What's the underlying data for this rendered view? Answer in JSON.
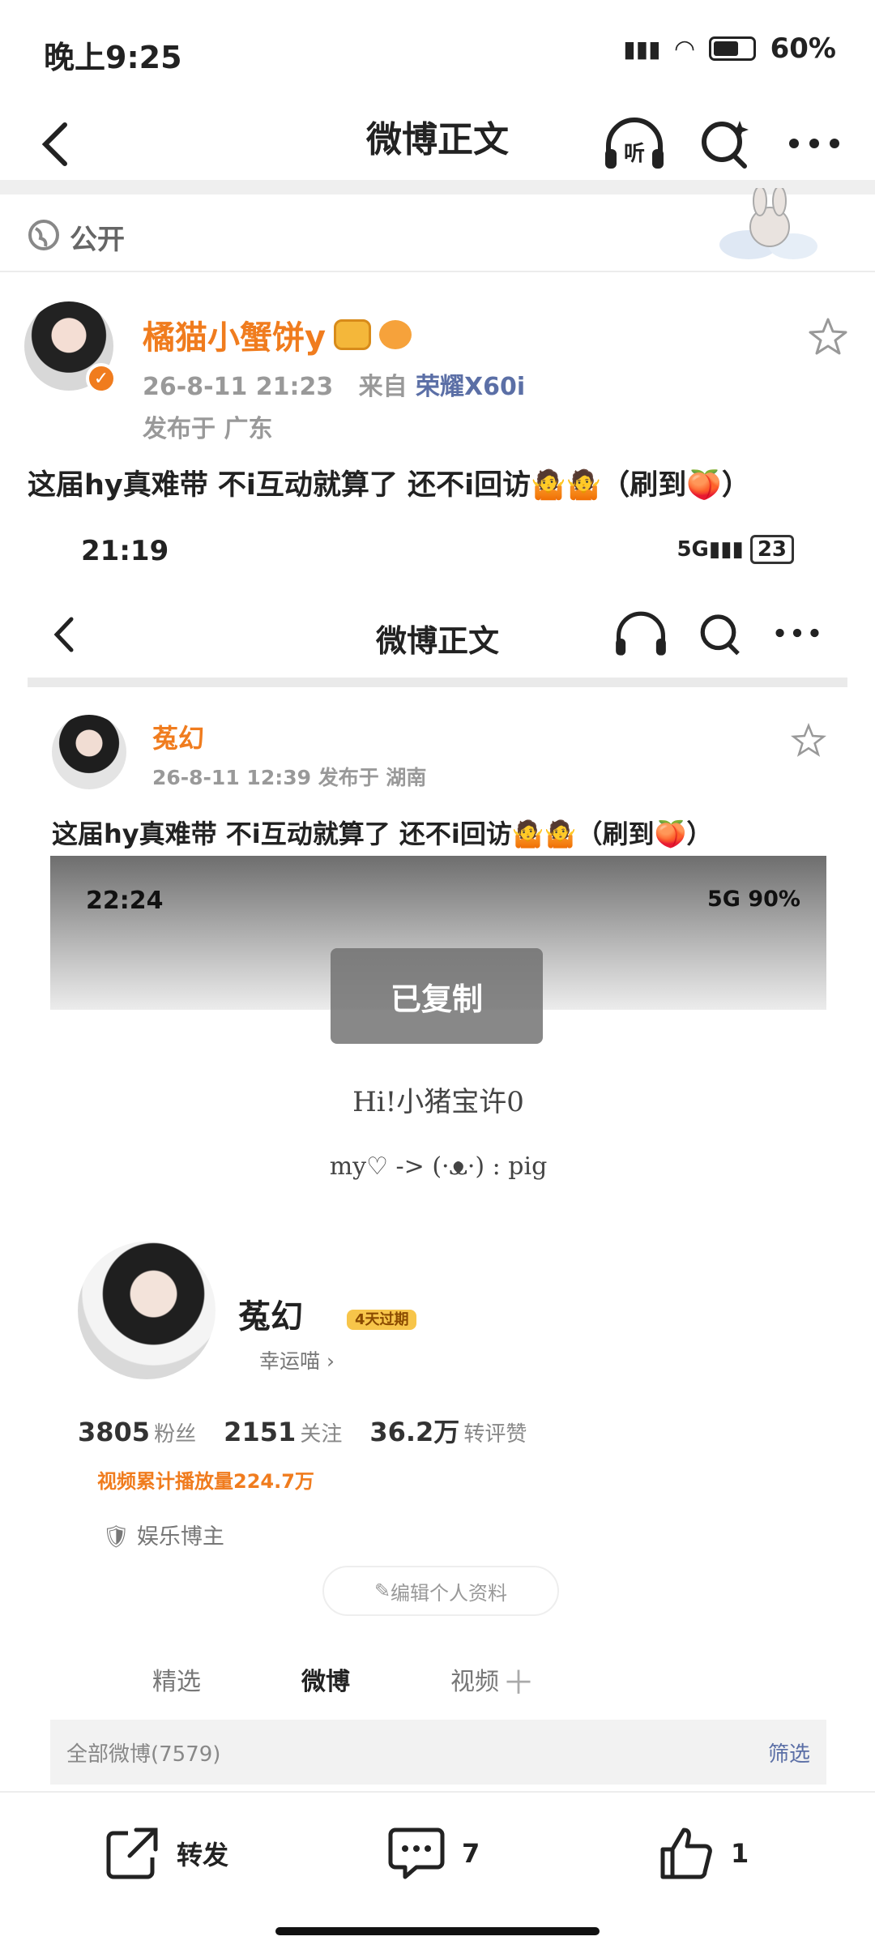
{
  "status_bar": {
    "time": "晚上9:25",
    "battery": "60%"
  },
  "header": {
    "title": "微博正文",
    "listen_icon_label": "听"
  },
  "visibility": {
    "label": "公开"
  },
  "post": {
    "author": "橘猫小蟹饼y",
    "date": "26-8-11 21:23",
    "from_label": "来自",
    "device": "荣耀X60i",
    "location": "发布于 广东",
    "text": "这届hy真难带 不i互动就算了 还不i回访🤷🤷（刷到🍑）"
  },
  "embedded": {
    "time": "21:19",
    "battery": "23",
    "header_title": "微博正文",
    "author": "菟幻",
    "meta": "26-8-11 12:39  发布于 湖南",
    "text": "这届hy真难带 不i互动就算了 还不i回访🤷🤷（刷到🍑）"
  },
  "inner": {
    "time": "22:24",
    "status": "5G  90%",
    "toast": "已复制",
    "handwriting_1": "Hi!小猪宝许0",
    "handwriting_2": "my♡ -> (·ᴥ·) : pig",
    "name": "菟幻",
    "badge": "4天过期",
    "lucky": "幸运喵 ›",
    "stats": [
      {
        "value": "3805",
        "label": "粉丝"
      },
      {
        "value": "2151",
        "label": "关注"
      },
      {
        "value": "36.2万",
        "label": "转评赞"
      }
    ],
    "plays": "视频累计播放量224.7万",
    "category": "娱乐博主",
    "edit_button": "编辑个人资料",
    "tabs": [
      "精选",
      "微博",
      "视频"
    ],
    "all_weibo": "全部微博(7579)",
    "filter": "筛选"
  },
  "actions": {
    "repost": "转发",
    "comments": "7",
    "likes": "1"
  },
  "colors": {
    "accent": "#f07c1e",
    "link": "#5b6fa6"
  }
}
